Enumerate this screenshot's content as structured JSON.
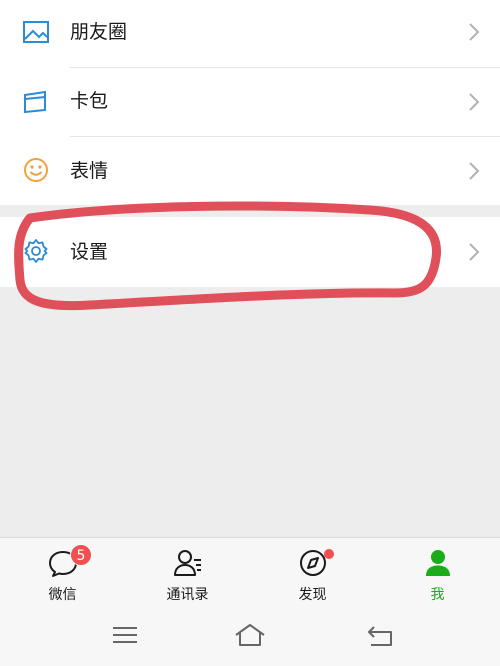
{
  "menu": {
    "moments": {
      "label": "朋友圈",
      "icon": "moments-icon"
    },
    "cards": {
      "label": "卡包",
      "icon": "card-wallet-icon"
    },
    "stickers": {
      "label": "表情",
      "icon": "smiley-icon"
    },
    "settings": {
      "label": "设置",
      "icon": "gear-icon"
    }
  },
  "tabbar": {
    "chats": {
      "label": "微信",
      "badge": "5",
      "icon": "chat-bubble-icon"
    },
    "contacts": {
      "label": "通讯录",
      "icon": "contacts-icon"
    },
    "discover": {
      "label": "发现",
      "icon": "compass-icon"
    },
    "me": {
      "label": "我",
      "icon": "person-icon"
    }
  },
  "colors": {
    "accent": "#1aad19",
    "icon_blue": "#2a8bd6",
    "icon_orange": "#f0a23b",
    "badge_red": "#f05050",
    "highlight_stroke": "#e0505a"
  }
}
